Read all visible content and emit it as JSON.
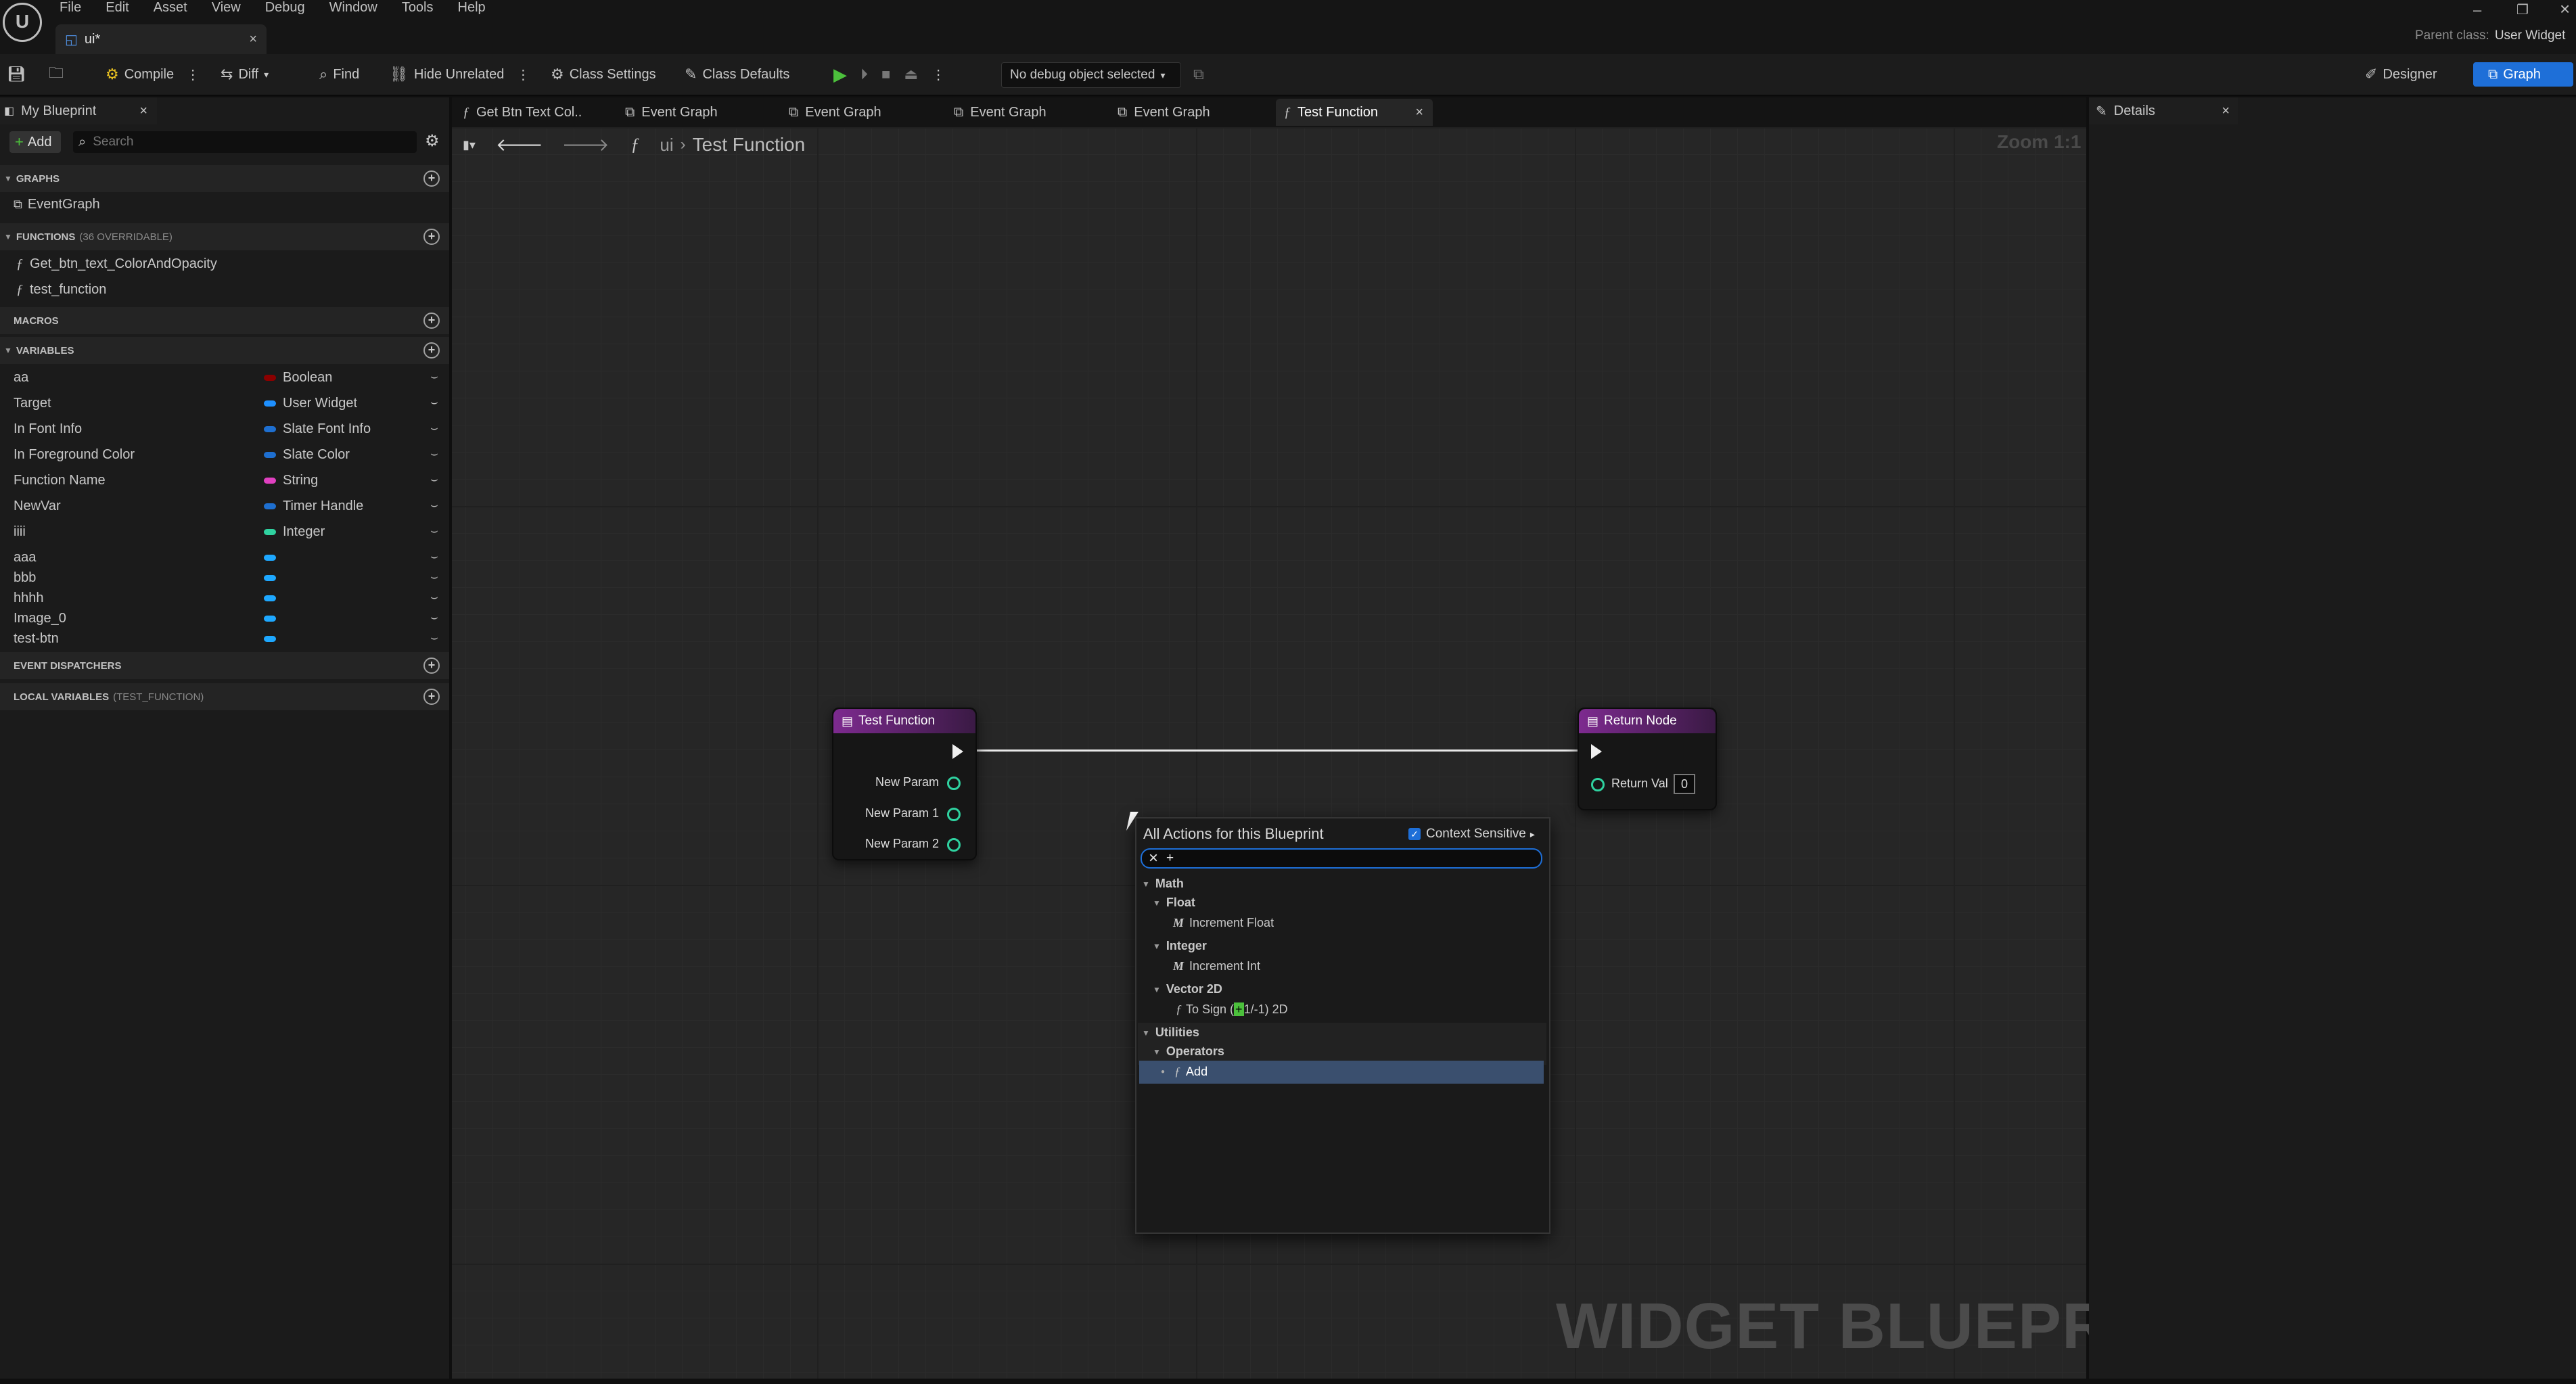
{
  "titlebar": {
    "menu": [
      "File",
      "Edit",
      "Asset",
      "View",
      "Debug",
      "Window",
      "Tools",
      "Help"
    ],
    "tab_label": "ui*",
    "parent_class_label": "Parent class:",
    "parent_class_value": "User Widget"
  },
  "toolbar": {
    "compile": "Compile",
    "diff": "Diff",
    "find": "Find",
    "hide_unrelated": "Hide Unrelated",
    "class_settings": "Class Settings",
    "class_defaults": "Class Defaults",
    "debug_select": "No debug object selected",
    "designer": "Designer",
    "graph": "Graph"
  },
  "my_blueprint": {
    "title": "My Blueprint",
    "add": "Add",
    "search_placeholder": "Search",
    "sections": {
      "graphs": "GRAPHS",
      "functions": "FUNCTIONS",
      "functions_note": "(36 OVERRIDABLE)",
      "macros": "MACROS",
      "variables": "VARIABLES",
      "event_dispatchers": "EVENT DISPATCHERS",
      "local_variables": "LOCAL VARIABLES",
      "local_variables_note": "(TEST_FUNCTION)"
    },
    "graphs": [
      "EventGraph"
    ],
    "functions": [
      "Get_btn_text_ColorAndOpacity",
      "test_function"
    ],
    "variables": [
      {
        "name": "aa",
        "type": "Boolean",
        "color": "#8b0000"
      },
      {
        "name": "Target",
        "type": "User Widget",
        "color": "#1e90ff"
      },
      {
        "name": "In Font Info",
        "type": "Slate Font Info",
        "color": "#1e6fd0"
      },
      {
        "name": "In Foreground Color",
        "type": "Slate Color",
        "color": "#1e6fd0"
      },
      {
        "name": "Function Name",
        "type": "String",
        "color": "#e040c0"
      },
      {
        "name": "NewVar",
        "type": "Timer Handle",
        "color": "#1e6fd0"
      },
      {
        "name": "iiii",
        "type": "Integer",
        "color": "#2fd2a0"
      },
      {
        "name": "aaa",
        "type": "",
        "color": "#1ea8ff"
      },
      {
        "name": "bbb",
        "type": "",
        "color": "#1ea8ff"
      },
      {
        "name": "hhhh",
        "type": "",
        "color": "#1ea8ff"
      },
      {
        "name": "Image_0",
        "type": "",
        "color": "#1ea8ff"
      },
      {
        "name": "test-btn",
        "type": "",
        "color": "#1ea8ff"
      }
    ]
  },
  "document_tabs": [
    "Get Btn Text Col..",
    "Event Graph",
    "Event Graph",
    "Event Graph",
    "Event Graph",
    "Test Function"
  ],
  "breadcrumb": {
    "root": "ui",
    "current": "Test Function"
  },
  "zoom": "Zoom 1:1",
  "watermark": "WIDGET BLUEPRINT",
  "nodes": {
    "entry": {
      "title": "Test Function",
      "pins": [
        "New Param",
        "New Param 1",
        "New Param 2"
      ]
    },
    "return": {
      "title": "Return Node",
      "pin": "Return Val",
      "value": "0"
    }
  },
  "context_menu": {
    "title": "All Actions for this Blueprint",
    "context_sensitive": "Context Sensitive",
    "search_value": "+",
    "tree": {
      "math": "Math",
      "float": "Float",
      "increment_float": "Increment Float",
      "integer": "Integer",
      "increment_int": "Increment Int",
      "vector2d": "Vector 2D",
      "to_sign_pre": "To Sign (",
      "to_sign_hl": "+",
      "to_sign_post": "1/-1) 2D",
      "utilities": "Utilities",
      "operators": "Operators",
      "add": "Add"
    }
  },
  "details": {
    "title": "Details"
  },
  "colors": {
    "accent": "#1e6fd8",
    "node_header": "#7d2a8f",
    "pin": "#2fd2a0"
  }
}
